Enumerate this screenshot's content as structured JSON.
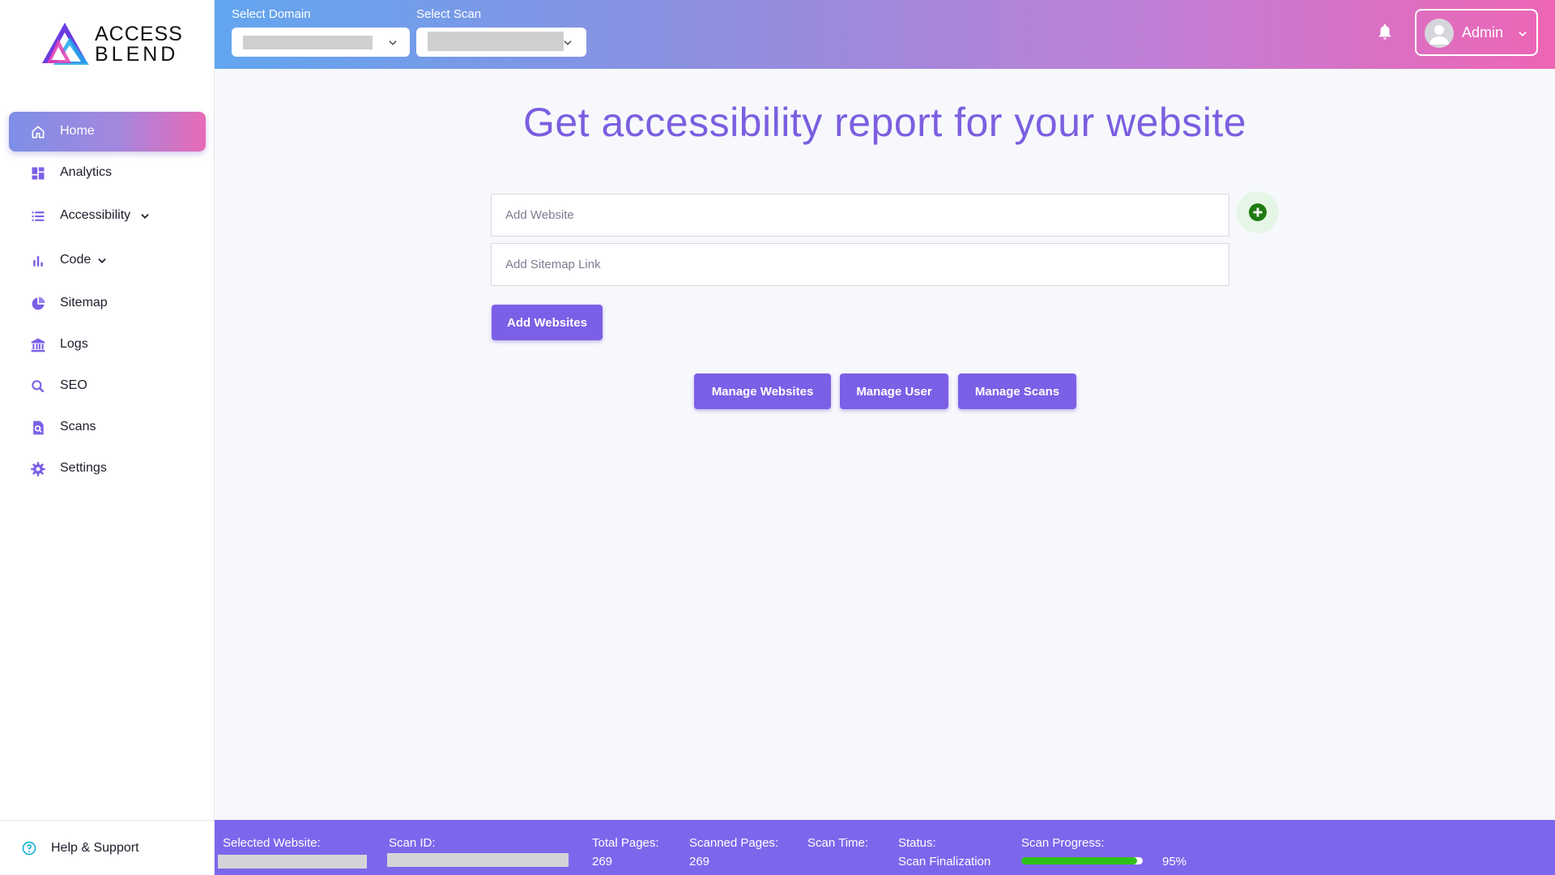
{
  "sidebar": {
    "logo": {
      "line1": "ACCESS",
      "line2": "BLEND"
    },
    "items": [
      {
        "label": "Home",
        "icon": "home-icon",
        "active": true
      },
      {
        "label": "Analytics",
        "icon": "dashboard-icon"
      },
      {
        "label": "Accessibility",
        "icon": "list-icon",
        "expandable": true
      },
      {
        "label": "Code",
        "icon": "bar-chart-icon",
        "expandable": true
      },
      {
        "label": "Sitemap",
        "icon": "pie-chart-icon"
      },
      {
        "label": "Logs",
        "icon": "bank-icon"
      },
      {
        "label": "SEO",
        "icon": "search-icon"
      },
      {
        "label": "Scans",
        "icon": "scan-search-icon"
      },
      {
        "label": "Settings",
        "icon": "gear-icon"
      }
    ],
    "help": {
      "label": "Help & Support",
      "icon": "help-circle-icon"
    }
  },
  "header": {
    "domain_label": "Select Domain",
    "scan_label": "Select Scan",
    "user_name": "Admin"
  },
  "main": {
    "title": "Get accessibility report for your website",
    "website_placeholder": "Add Website",
    "sitemap_placeholder": "Add Sitemap Link",
    "add_websites_label": "Add Websites",
    "manage_websites_label": "Manage Websites",
    "manage_user_label": "Manage User",
    "manage_scans_label": "Manage Scans"
  },
  "footer": {
    "selected_website_label": "Selected Website:",
    "scan_id_label": "Scan ID:",
    "total_pages_label": "Total Pages:",
    "total_pages": "269",
    "scanned_pages_label": "Scanned Pages:",
    "scanned_pages": "269",
    "scan_time_label": "Scan Time:",
    "status_label": "Status:",
    "status": "Scan Finalization",
    "progress_label": "Scan Progress:",
    "progress_text": "95%",
    "progress_value": 95
  },
  "colors": {
    "accent": "#7b5fe6",
    "title": "#7b5fe0",
    "progress": "#2ec01a",
    "footer_bg": "#7e66ec",
    "plus_icon": "#1f7a12"
  }
}
